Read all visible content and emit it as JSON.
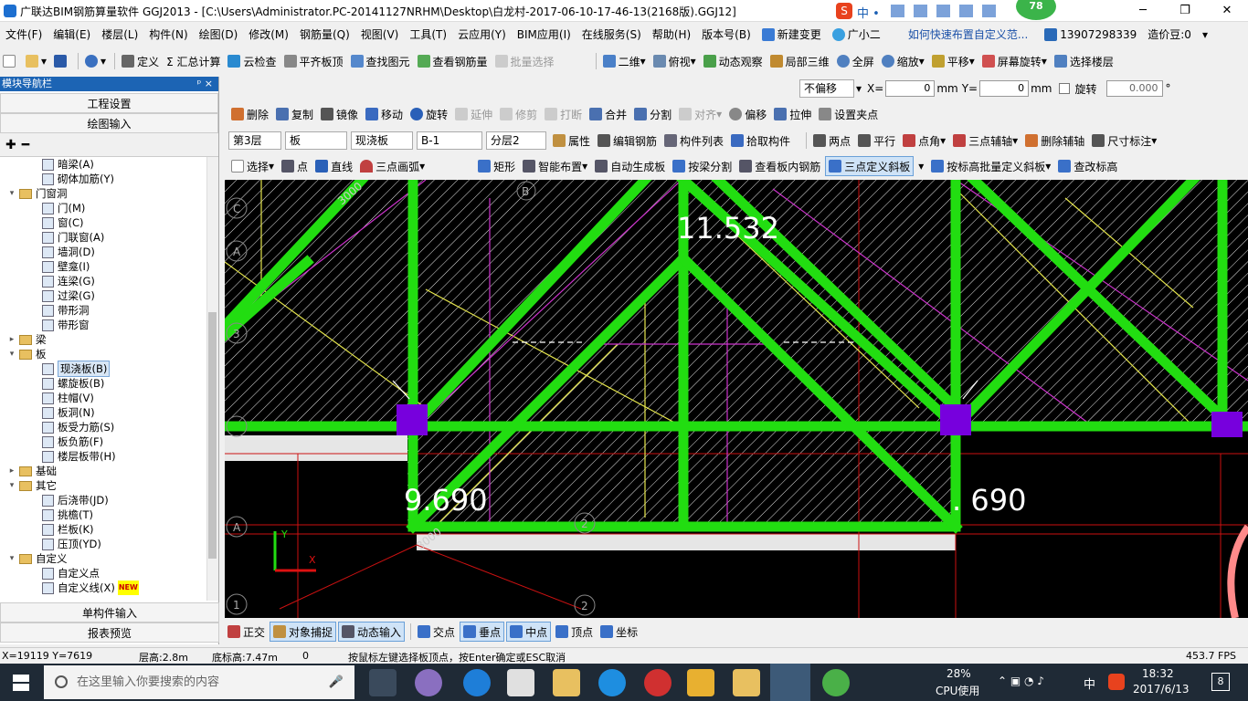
{
  "window": {
    "title": "广联达BIM钢筋算量软件 GGJ2013 - [C:\\Users\\Administrator.PC-20141127NRHM\\Desktop\\白龙村-2017-06-10-17-46-13(2168版).GGJ12]",
    "badge": "78",
    "ime_icons": "中 •"
  },
  "menu": {
    "items": [
      "文件(F)",
      "编辑(E)",
      "楼层(L)",
      "构件(N)",
      "绘图(D)",
      "修改(M)",
      "钢筋量(Q)",
      "视图(V)",
      "工具(T)",
      "云应用(Y)",
      "BIM应用(I)",
      "在线服务(S)",
      "帮助(H)",
      "版本号(B)",
      "新建变更",
      "广小二"
    ],
    "help_link": "如何快速布置自定义范...",
    "phone": "13907298339",
    "coins": "造价豆:0"
  },
  "toolbar1": {
    "items": [
      "定义",
      "Σ 汇总计算",
      "云检查",
      "平齐板顶",
      "查找图元",
      "查看钢筋量",
      "批量选择"
    ],
    "view_items": [
      "二维",
      "俯视",
      "动态观察",
      "局部三维",
      "全屏",
      "缩放",
      "平移",
      "屏幕旋转",
      "选择楼层"
    ]
  },
  "offset": {
    "mode": "不偏移",
    "x_label": "X=",
    "x_value": "0",
    "y_label": "Y=",
    "y_value": "0",
    "unit": "mm",
    "rotate_label": "旋转",
    "rotate_value": "0.000",
    "deg": "°"
  },
  "nav": {
    "header": "模块导航栏",
    "pin": "ᵖ ×",
    "top_buttons": [
      "工程设置",
      "绘图输入"
    ],
    "bottom_buttons": [
      "单构件输入",
      "报表预览"
    ],
    "tree": [
      {
        "label": "暗梁(A)",
        "level": 2
      },
      {
        "label": "砌体加筋(Y)",
        "level": 2
      },
      {
        "label": "门窗洞",
        "level": 1,
        "folder": true,
        "exp": "−"
      },
      {
        "label": "门(M)",
        "level": 2
      },
      {
        "label": "窗(C)",
        "level": 2
      },
      {
        "label": "门联窗(A)",
        "level": 2
      },
      {
        "label": "墙洞(D)",
        "level": 2
      },
      {
        "label": "壁龛(I)",
        "level": 2
      },
      {
        "label": "连梁(G)",
        "level": 2
      },
      {
        "label": "过梁(G)",
        "level": 2
      },
      {
        "label": "带形洞",
        "level": 2
      },
      {
        "label": "带形窗",
        "level": 2
      },
      {
        "label": "梁",
        "level": 1,
        "folder": true,
        "exp": "+"
      },
      {
        "label": "板",
        "level": 1,
        "folder": true,
        "exp": "−"
      },
      {
        "label": "现浇板(B)",
        "level": 2,
        "selected": true
      },
      {
        "label": "螺旋板(B)",
        "level": 2
      },
      {
        "label": "柱帽(V)",
        "level": 2
      },
      {
        "label": "板洞(N)",
        "level": 2
      },
      {
        "label": "板受力筋(S)",
        "level": 2
      },
      {
        "label": "板负筋(F)",
        "level": 2
      },
      {
        "label": "楼层板带(H)",
        "level": 2
      },
      {
        "label": "基础",
        "level": 1,
        "folder": true,
        "exp": "+"
      },
      {
        "label": "其它",
        "level": 1,
        "folder": true,
        "exp": "−"
      },
      {
        "label": "后浇带(JD)",
        "level": 2
      },
      {
        "label": "挑檐(T)",
        "level": 2
      },
      {
        "label": "栏板(K)",
        "level": 2
      },
      {
        "label": "压顶(YD)",
        "level": 2
      },
      {
        "label": "自定义",
        "level": 1,
        "folder": true,
        "exp": "−"
      },
      {
        "label": "自定义点",
        "level": 2
      },
      {
        "label": "自定义线(X)",
        "level": 2,
        "new": "NEW"
      }
    ]
  },
  "edit_toolbar": [
    "删除",
    "复制",
    "镜像",
    "移动",
    "旋转",
    "延伸",
    "修剪",
    "打断",
    "合并",
    "分割",
    "对齐",
    "偏移",
    "拉伸",
    "设置夹点"
  ],
  "layer_toolbar": {
    "floor": "第3层",
    "type": "板",
    "subtype": "现浇板",
    "name": "B-1",
    "layer": "分层2",
    "items": [
      "属性",
      "编辑钢筋",
      "构件列表",
      "拾取构件"
    ],
    "axis_items": [
      "两点",
      "平行",
      "点角",
      "三点辅轴",
      "删除辅轴",
      "尺寸标注"
    ]
  },
  "draw_toolbar": [
    "选择",
    "点",
    "直线",
    "三点画弧",
    "矩形",
    "智能布置",
    "自动生成板",
    "按梁分割",
    "查看板内钢筋",
    "三点定义斜板",
    "按标高批量定义斜板",
    "查改标高"
  ],
  "canvas": {
    "elev_top": "11.532",
    "elev_left": "9.690",
    "elev_right": ". 690",
    "dim_top": "3000",
    "dim_bottom": "3000",
    "axis_C": "C",
    "axis_A": "A",
    "axis_A2": "A",
    "axis_B": "B",
    "axis_3": "3",
    "axis_1": "1",
    "axis_2": "2",
    "axis_2b": "2",
    "coord_y": "Y",
    "coord_x": "X"
  },
  "snap": [
    "正交",
    "对象捕捉",
    "动态输入",
    "交点",
    "垂点",
    "中点",
    "顶点",
    "坐标"
  ],
  "status": {
    "coords": "X=19119 Y=7619",
    "floor_height": "层高:2.8m",
    "base_height": "底标高:7.47m",
    "zero": "0",
    "hint": "按鼠标左键选择板顶点，按Enter确定或ESC取消",
    "fps": "453.7 FPS"
  },
  "taskbar": {
    "search_placeholder": "在这里输入你要搜索的内容",
    "cpu_pct": "28%",
    "cpu_label": "CPU使用",
    "ime": "中",
    "time": "18:32",
    "date": "2017/6/13",
    "notif": "8"
  },
  "colors": {
    "beam": "#22dd11",
    "column": "#7700dd",
    "hatch": "#ffffff",
    "magenta": "#cc33cc",
    "yellow": "#e6e64d",
    "red": "#cc1111"
  }
}
